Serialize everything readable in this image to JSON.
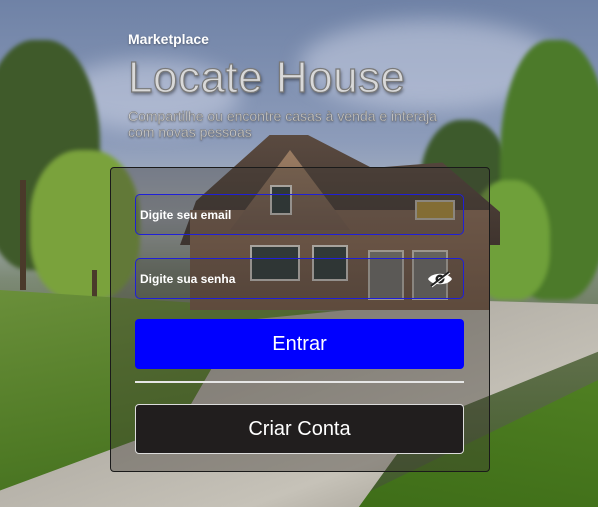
{
  "header": {
    "brand": "Marketplace",
    "title": "Locate House",
    "subtitle": "Compartilhe ou encontre casas à venda e interaja com novas pessoas"
  },
  "login": {
    "email_placeholder": "Digite seu email",
    "email_value": "",
    "password_placeholder": "Digite sua senha",
    "password_value": "",
    "password_toggle_icon": "eye-hidden-icon",
    "submit_label": "Entrar",
    "create_account_label": "Criar Conta"
  },
  "colors": {
    "primary_button": "#0000ff",
    "secondary_button": "#211e1e",
    "input_border": "#1f1fd8"
  }
}
